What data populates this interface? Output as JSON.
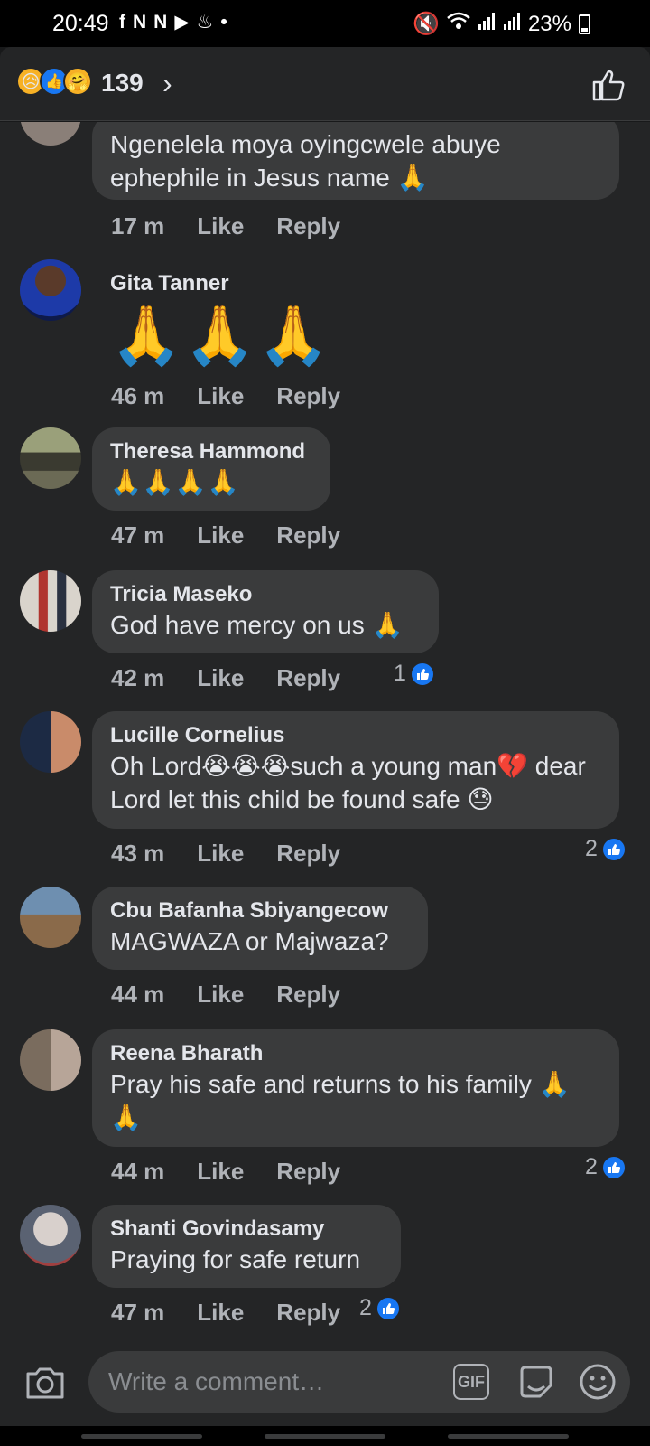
{
  "status": {
    "time": "20:49",
    "notif_icons": [
      "f",
      "N",
      "N",
      "▶",
      "♨",
      "•"
    ],
    "battery": "23%"
  },
  "header": {
    "reaction_count": "139",
    "reactions": [
      "sad",
      "like",
      "care"
    ]
  },
  "comments": [
    {
      "author": "",
      "text": "Ngenelela moya oyingcwele abuye ephephile in Jesus name 🙏",
      "time": "17 m",
      "like": "Like",
      "reply": "Reply",
      "likes": ""
    },
    {
      "author": "Gita Tanner",
      "text": "🙏🙏🙏",
      "time": "46 m",
      "like": "Like",
      "reply": "Reply",
      "likes": ""
    },
    {
      "author": "Theresa Hammond",
      "text": "🙏🙏🙏🙏",
      "time": "47 m",
      "like": "Like",
      "reply": "Reply",
      "likes": ""
    },
    {
      "author": "Tricia Maseko",
      "text": "God have mercy on us 🙏",
      "time": "42 m",
      "like": "Like",
      "reply": "Reply",
      "likes": "1"
    },
    {
      "author": "Lucille Cornelius",
      "text": "Oh Lord😭😭😭such a young man💔 dear Lord let this child be found safe 😓",
      "time": "43 m",
      "like": "Like",
      "reply": "Reply",
      "likes": "2"
    },
    {
      "author": "Cbu Bafanha Sbiyangecow",
      "text": "MAGWAZA or Majwaza?",
      "time": "44 m",
      "like": "Like",
      "reply": "Reply",
      "likes": ""
    },
    {
      "author": "Reena Bharath",
      "text": "Pray his safe and returns to his family 🙏 🙏",
      "time": "44 m",
      "like": "Like",
      "reply": "Reply",
      "likes": "2"
    },
    {
      "author": "Shanti Govindasamy",
      "text": "Praying for safe return",
      "time": "47 m",
      "like": "Like",
      "reply": "Reply",
      "likes": "2"
    }
  ],
  "composer": {
    "placeholder": "Write a comment…",
    "gif": "GIF"
  },
  "colors": {
    "background": "#242526",
    "bubble": "#3a3b3c",
    "accent": "#1877f2",
    "muted": "#b0b3b8"
  }
}
